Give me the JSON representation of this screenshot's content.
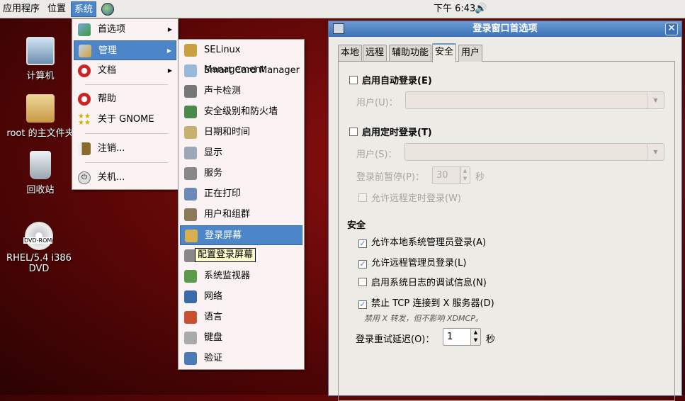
{
  "panel": {
    "menus": [
      "应用程序",
      "位置",
      "系统"
    ],
    "clock": "下午 6:43"
  },
  "desktop": {
    "icons": [
      "计算机",
      "root 的主文件夹",
      "回收站",
      "RHEL/5.4 i386 DVD"
    ],
    "dvd_badge": "DVD-ROM"
  },
  "system_menu": {
    "items": [
      {
        "label": "首选项",
        "icon": "preferences-icon",
        "submenu": true
      },
      {
        "label": "管理",
        "icon": "administration-icon",
        "submenu": true,
        "active": true
      },
      {
        "label": "文档",
        "icon": "lifebuoy-icon",
        "submenu": true
      },
      {
        "label": "帮助",
        "icon": "lifebuoy-icon"
      },
      {
        "label": "关于 GNOME",
        "icon": "gnome-stars-icon"
      },
      {
        "label": "注销...",
        "icon": "logout-icon"
      },
      {
        "label": "关机...",
        "icon": "power-icon"
      }
    ]
  },
  "admin_menu": {
    "items": [
      "SELinux Management",
      "Smart Card Manager",
      "声卡检测",
      "安全级别和防火墙",
      "日期和时间",
      "显示",
      "服务",
      "正在打印",
      "用户和组群",
      "登录屏幕",
      "",
      "系统监视器",
      "网络",
      "语言",
      "键盘",
      "验证"
    ],
    "active_index": 9
  },
  "tooltip": "配置登录屏幕",
  "dialog": {
    "title": "登录窗口首选项",
    "tabs": [
      "本地",
      "远程",
      "辅助功能",
      "安全",
      "用户"
    ],
    "active_tab": "安全",
    "auto_login": {
      "label": "启用自动登录(E)",
      "checked": false,
      "user_label": "用户(U)：",
      "user_value": ""
    },
    "timed_login": {
      "label": "启用定时登录(T)",
      "checked": false,
      "user_label": "用户(S)：",
      "user_value": "",
      "pause_label": "登录前暂停(P)：",
      "pause_value": "30",
      "pause_unit": "秒",
      "remote_label": "允许远程定时登录(W)",
      "remote_checked": false
    },
    "security": {
      "heading": "安全",
      "options": [
        {
          "label": "允许本地系统管理员登录(A)",
          "checked": true
        },
        {
          "label": "允许远程管理员登录(L)",
          "checked": true
        },
        {
          "label": "启用系统日志的调试信息(N)",
          "checked": false
        },
        {
          "label": "禁止 TCP 连接到 X 服务器(D)",
          "checked": true
        }
      ],
      "hint": "禁用 X 转发，但不影响 XDMCP。",
      "retry_label": "登录重试延迟(O)：",
      "retry_value": "1",
      "retry_unit": "秒"
    }
  },
  "colors": {
    "accent": "#4c86c8",
    "desktop": "#6a0a0a"
  }
}
